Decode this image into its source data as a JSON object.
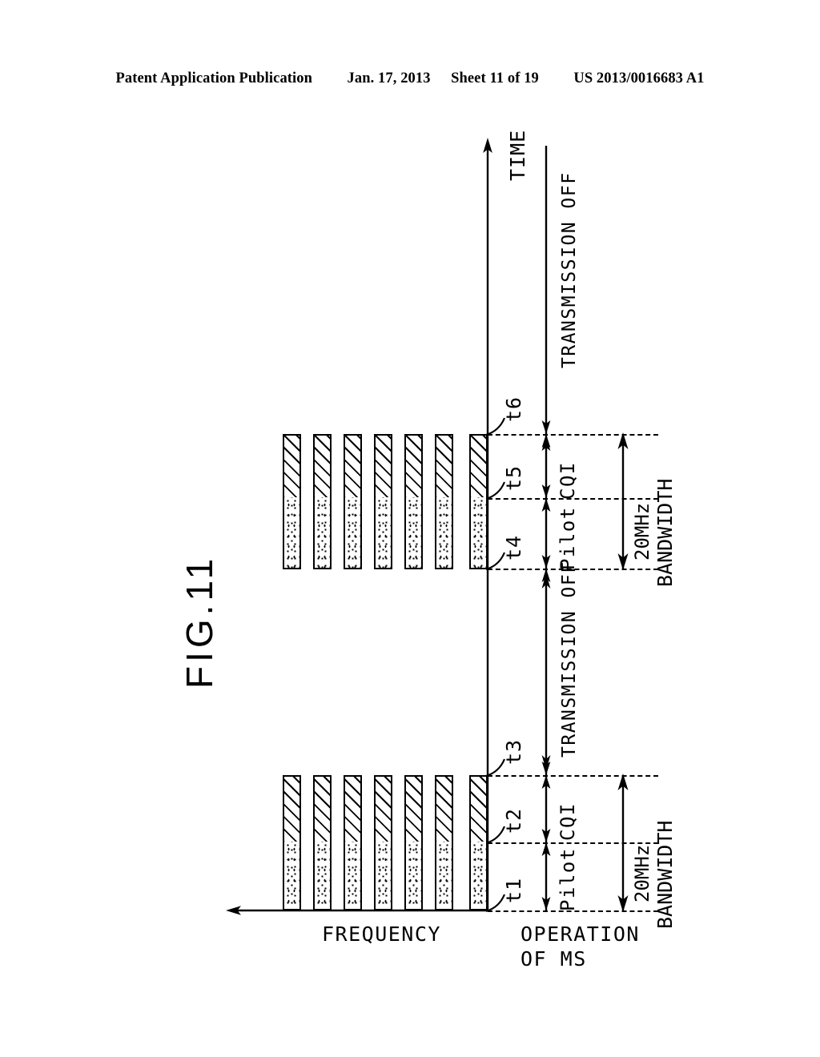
{
  "header": {
    "left": "Patent Application Publication",
    "date": "Jan. 17, 2013",
    "sheet": "Sheet 11 of 19",
    "pub_number": "US 2013/0016683 A1"
  },
  "figure": {
    "title": "FIG.11",
    "axes": {
      "time_label": "TIME",
      "frequency_label": "FREQUENCY",
      "operation_label_line1": "OPERATION",
      "operation_label_line2": "OF MS"
    },
    "bar_groups": [
      {
        "id": "upper-burst",
        "bar_count": 7,
        "segments": [
          {
            "name": "CQI",
            "fill": "hatch"
          },
          {
            "name": "Pilot",
            "fill": "dots"
          }
        ],
        "bandwidth_value": "20MHz",
        "bandwidth_label": "BANDWIDTH",
        "time_marks": [
          "t6",
          "t5",
          "t4"
        ]
      },
      {
        "id": "lower-burst",
        "bar_count": 7,
        "segments": [
          {
            "name": "CQI",
            "fill": "hatch"
          },
          {
            "name": "Pilot",
            "fill": "dots"
          }
        ],
        "bandwidth_value": "20MHz",
        "bandwidth_label": "BANDWIDTH",
        "time_marks": [
          "t3",
          "t2",
          "t1"
        ]
      }
    ],
    "transmission_off_upper": "TRANSMISSION OFF",
    "transmission_off_middle": "TRANSMISSION OFF",
    "segment_labels": {
      "cqi": "CQI",
      "pilot": "Pilot"
    },
    "colors": {
      "ink": "#000000",
      "paper": "#ffffff"
    }
  }
}
